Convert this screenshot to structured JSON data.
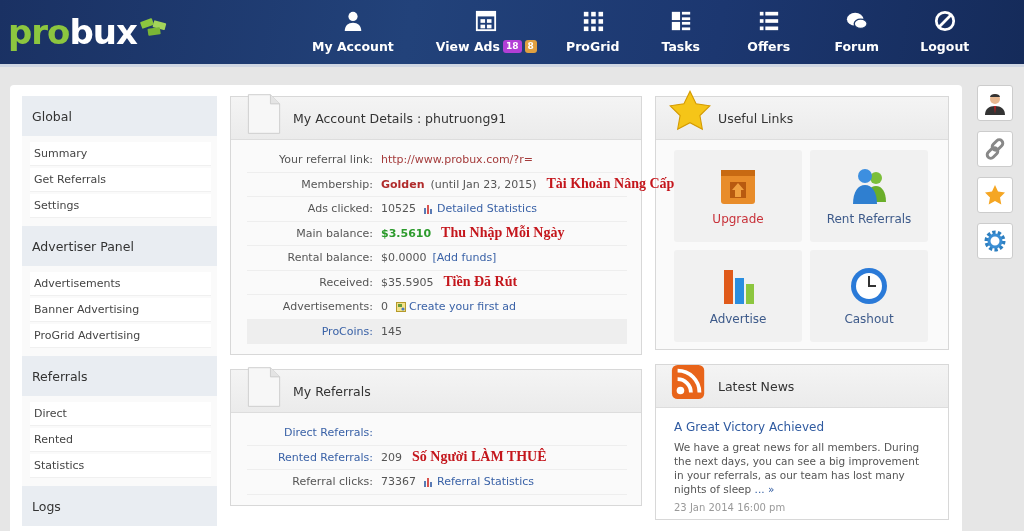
{
  "logo": {
    "accent": "pro",
    "rest": "bux"
  },
  "nav": [
    {
      "label": "My Account"
    },
    {
      "label": "View Ads",
      "badges": [
        {
          "text": "18",
          "color": "#b23fd6"
        },
        {
          "text": "8",
          "color": "#e0a040"
        }
      ]
    },
    {
      "label": "ProGrid"
    },
    {
      "label": "Tasks"
    },
    {
      "label": "Offers"
    },
    {
      "label": "Forum"
    },
    {
      "label": "Logout"
    }
  ],
  "sidebar": [
    {
      "title": "Global",
      "items": [
        "Summary",
        "Get Referrals",
        "Settings"
      ]
    },
    {
      "title": "Advertiser Panel",
      "items": [
        "Advertisements",
        "Banner Advertising",
        "ProGrid Advertising"
      ]
    },
    {
      "title": "Referrals",
      "items": [
        "Direct",
        "Rented",
        "Statistics"
      ]
    },
    {
      "title": "Logs"
    }
  ],
  "account": {
    "title": "My Account Details : phutruong91",
    "rows": [
      {
        "label": "Your referral link:",
        "label_link": false,
        "highlighted": false,
        "parts": [
          {
            "kind": "url",
            "text": "http://www.probux.com/?r="
          }
        ]
      },
      {
        "label": "Membership:",
        "label_link": false,
        "highlighted": false,
        "parts": [
          {
            "kind": "golden",
            "text": "Golden"
          },
          {
            "kind": "text",
            "text": "(until Jan 23, 2015)"
          },
          {
            "kind": "note",
            "text": "Tài Khoản Nâng Cấp"
          }
        ]
      },
      {
        "label": "Ads clicked:",
        "label_link": false,
        "highlighted": false,
        "parts": [
          {
            "kind": "text",
            "text": "10525"
          },
          {
            "kind": "stat-link",
            "text": "Detailed Statistics"
          }
        ]
      },
      {
        "label": "Main balance:",
        "label_link": false,
        "highlighted": false,
        "parts": [
          {
            "kind": "money",
            "text": "$3.5610"
          },
          {
            "kind": "note",
            "text": "Thu Nhập Mỗi Ngày"
          }
        ]
      },
      {
        "label": "Rental balance:",
        "label_link": false,
        "highlighted": false,
        "parts": [
          {
            "kind": "text",
            "text": "$0.0000"
          },
          {
            "kind": "link",
            "text": "[Add funds]"
          }
        ]
      },
      {
        "label": "Received:",
        "label_link": false,
        "highlighted": false,
        "parts": [
          {
            "kind": "text",
            "text": "$35.5905"
          },
          {
            "kind": "note",
            "text": "Tiền Đã Rút"
          }
        ]
      },
      {
        "label": "Advertisements:",
        "label_link": false,
        "highlighted": false,
        "parts": [
          {
            "kind": "text",
            "text": "0"
          },
          {
            "kind": "ad-link",
            "text": "Create your first ad"
          }
        ]
      },
      {
        "label": "ProCoins:",
        "label_link": true,
        "highlighted": true,
        "parts": [
          {
            "kind": "text",
            "text": "145"
          }
        ]
      }
    ]
  },
  "referrals": {
    "title": "My Referrals",
    "rows": [
      {
        "label": "Direct Referrals:",
        "label_link": true,
        "highlighted": false,
        "parts": []
      },
      {
        "label": "Rented Referrals:",
        "label_link": true,
        "highlighted": false,
        "parts": [
          {
            "kind": "text",
            "text": "209"
          },
          {
            "kind": "note",
            "text": "Số Người LÀM THUÊ"
          }
        ]
      },
      {
        "label": "Referral clicks:",
        "label_link": false,
        "highlighted": false,
        "parts": [
          {
            "kind": "text",
            "text": "73367"
          },
          {
            "kind": "stat-link",
            "text": "Referral Statistics"
          }
        ]
      }
    ]
  },
  "useful_links": {
    "title": "Useful Links",
    "tiles": [
      {
        "label": "Upgrade",
        "accent": true
      },
      {
        "label": "Rent Referrals",
        "accent": false
      },
      {
        "label": "Advertise",
        "accent": false
      },
      {
        "label": "Cashout",
        "accent": false
      }
    ]
  },
  "news": {
    "title": "Latest News",
    "headline": "A Great Victory Achieved",
    "body": "We have a great news for all members. During the next days, you can see a big improvement in your referrals, as our team has lost many nights of sleep",
    "more": "... »",
    "date": "23 Jan 2014 16:00 pm"
  }
}
